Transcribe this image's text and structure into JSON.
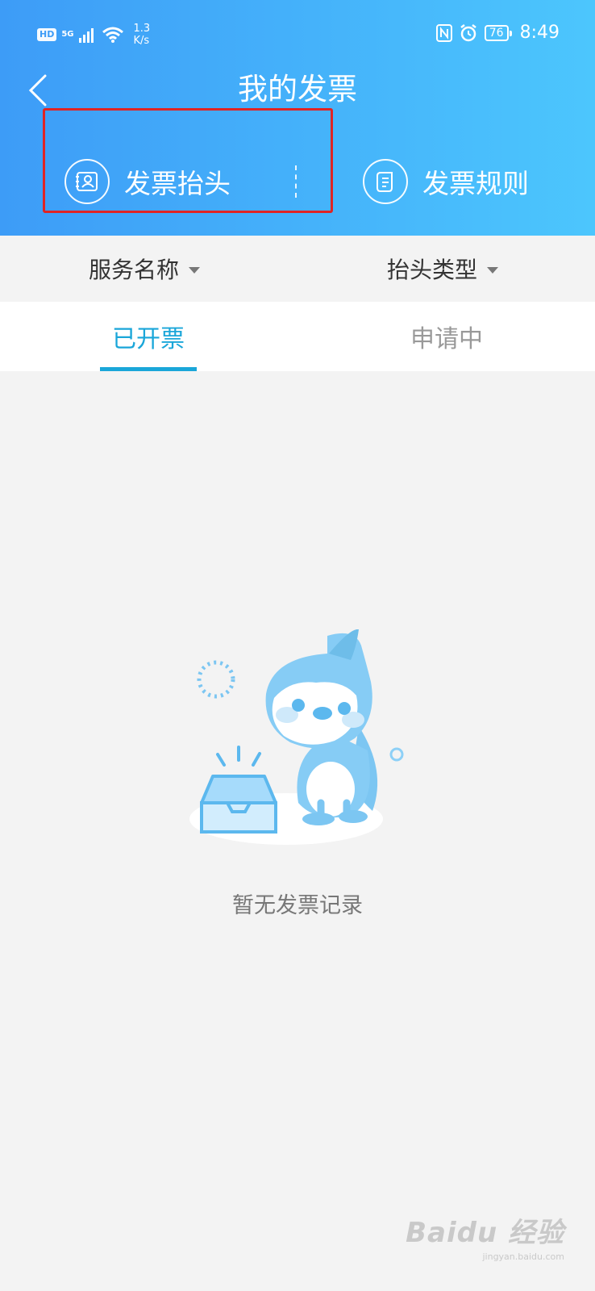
{
  "status_bar": {
    "network_badge": "HD",
    "signal_type": "5G",
    "speed_value": "1.3",
    "speed_unit": "K/s",
    "battery": "76",
    "time": "8:49"
  },
  "header": {
    "title": "我的发票",
    "actions": [
      {
        "label": "发票抬头",
        "icon": "contact-card-icon"
      },
      {
        "label": "发票规则",
        "icon": "scroll-document-icon"
      }
    ]
  },
  "filters": [
    {
      "label": "服务名称"
    },
    {
      "label": "抬头类型"
    }
  ],
  "tabs": [
    {
      "label": "已开票",
      "active": true
    },
    {
      "label": "申请中",
      "active": false
    }
  ],
  "empty_state": {
    "message": "暂无发票记录",
    "illustration": "penguin-with-empty-box"
  },
  "watermark": {
    "brand": "Baidu 经验",
    "site": "jingyan.baidu.com"
  },
  "colors": {
    "header_gradient_start": "#3d9cf7",
    "header_gradient_end": "#4cc6fd",
    "accent": "#1aa6d9",
    "highlight": "#e02424",
    "background": "#f3f3f3"
  }
}
